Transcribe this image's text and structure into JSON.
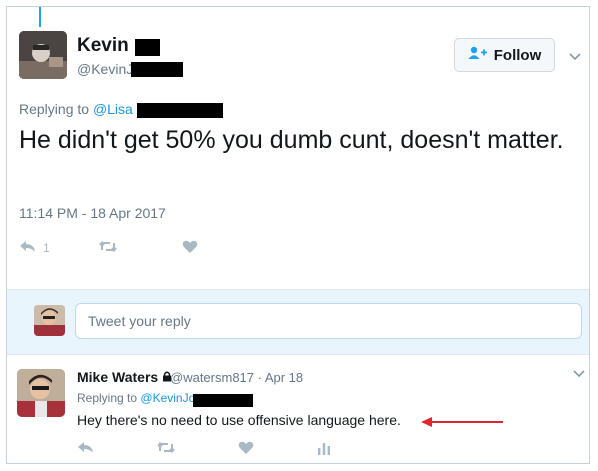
{
  "tweet": {
    "author_name": "Kevin",
    "author_handle": "@KevinJ",
    "follow_label": "Follow",
    "replying_prefix": "Replying to",
    "replying_handle": "@Lisa",
    "text": "He didn't get 50% you dumb cunt, doesn't matter.",
    "timestamp": "11:14 PM - 18 Apr 2017",
    "reply_count": "1",
    "retweet_count": "",
    "like_count": ""
  },
  "reply_box": {
    "placeholder": "Tweet your reply"
  },
  "reply_tweet": {
    "author_name": "Mike Waters",
    "meta": "@watersm817 · Apr 18",
    "replying_prefix": "Replying to",
    "replying_handle": "@KevinJc",
    "text": "Hey there's no need to use offensive language here."
  },
  "icons": {
    "reply": "reply-icon",
    "retweet": "retweet-icon",
    "like": "heart-icon",
    "analytics": "analytics-icon",
    "lock": "lock-icon",
    "follow": "add-user-icon",
    "caret": "chevron-down-icon"
  },
  "colors": {
    "link": "#1b95e0",
    "action_gray": "#aab8c2",
    "annotation_arrow": "#e0262f"
  }
}
